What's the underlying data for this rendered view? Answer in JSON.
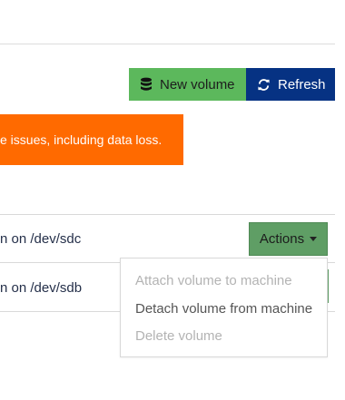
{
  "toolbar": {
    "new_volume_label": "New volume",
    "new_volume_icon": "database-icon",
    "refresh_label": "Refresh",
    "refresh_icon": "refresh-icon"
  },
  "alert": {
    "text": "e issues, including data loss."
  },
  "rows": [
    {
      "text": "n on /dev/sdc"
    },
    {
      "text": "n on /dev/sdb"
    }
  ],
  "actions": {
    "label": "Actions",
    "menu": [
      {
        "label": "Attach volume to machine",
        "disabled": true
      },
      {
        "label": "Detach volume from machine",
        "disabled": false
      },
      {
        "label": "Delete volume",
        "disabled": true
      }
    ]
  },
  "colors": {
    "new_volume_bg": "#5cb85c",
    "refresh_bg": "#063283",
    "alert_bg": "#ff6a00",
    "actions_bg": "#5f9e65"
  }
}
